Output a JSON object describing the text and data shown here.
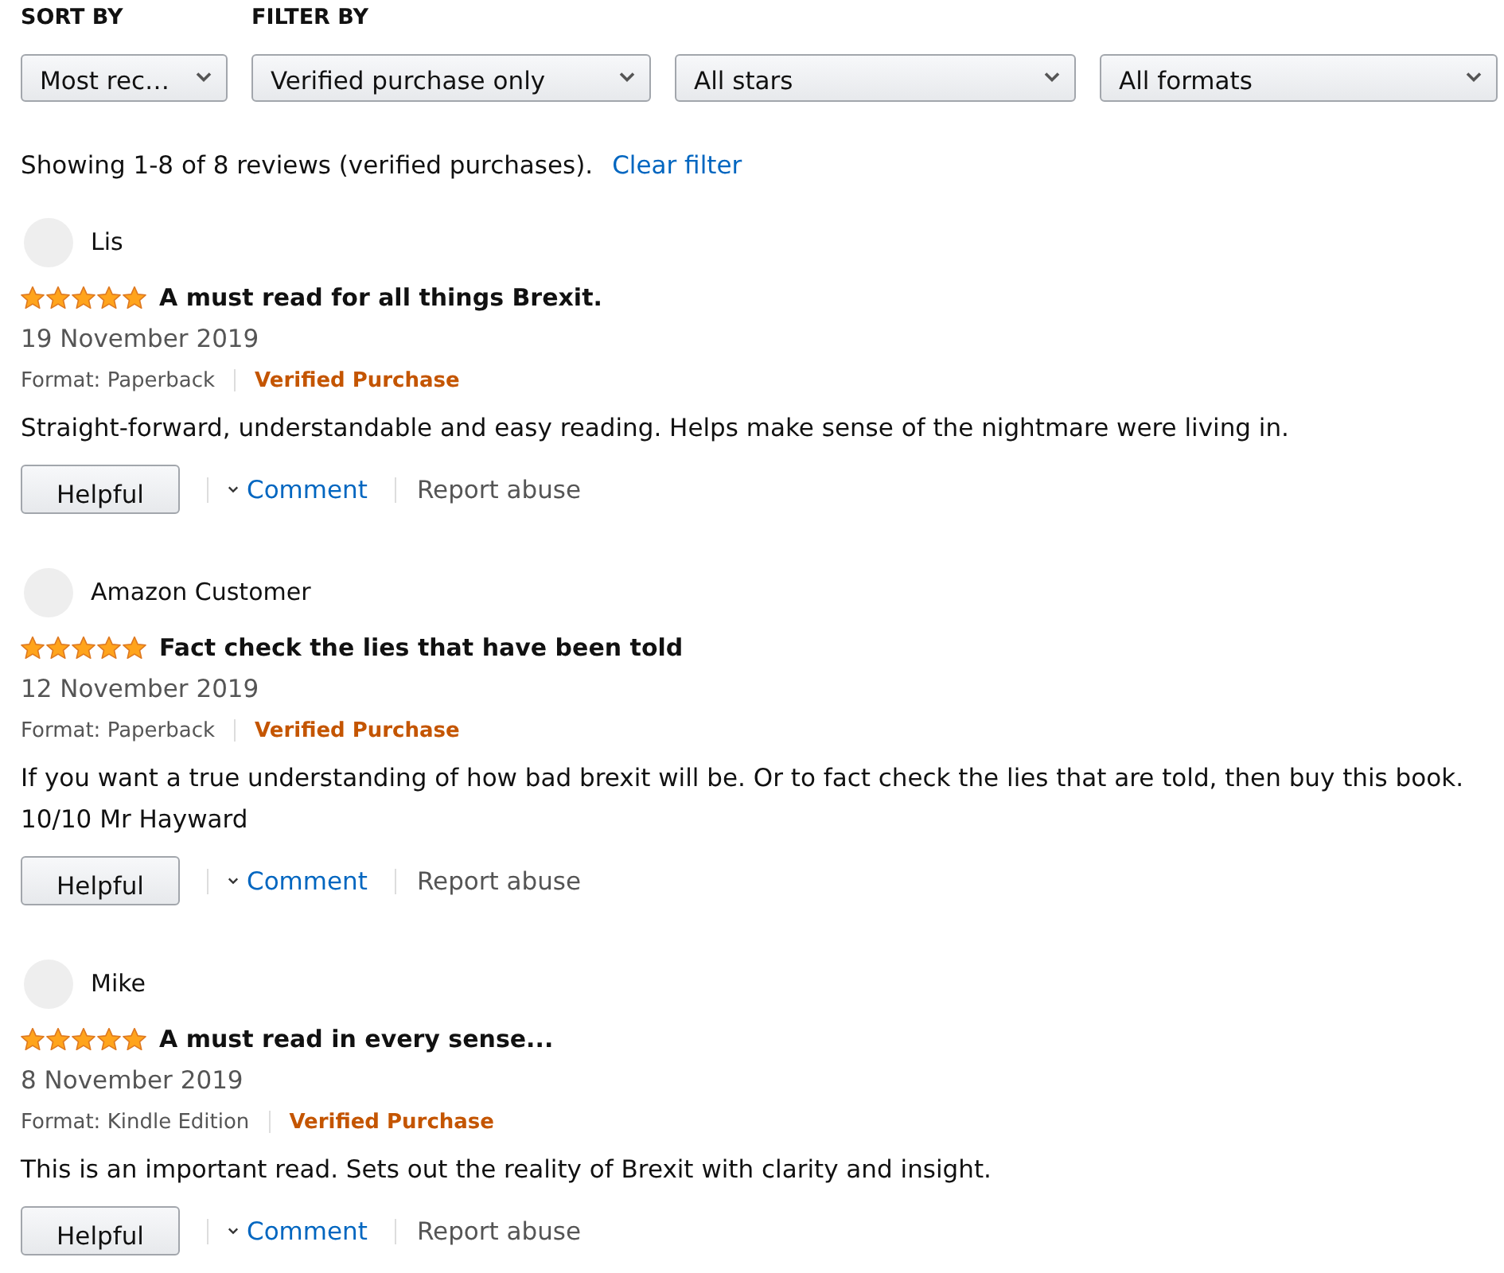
{
  "sort": {
    "label": "SORT BY",
    "value": "Most rec…"
  },
  "filter": {
    "label": "FILTER BY",
    "dropdowns": [
      {
        "value": "Verified purchase only"
      },
      {
        "value": "All stars"
      },
      {
        "value": "All formats"
      }
    ]
  },
  "summary": {
    "text": "Showing 1-8 of 8 reviews (verified purchases).",
    "clear_link": "Clear filter"
  },
  "reviews": [
    {
      "author": "Lis",
      "stars": 5,
      "title": "A must read for all things Brexit.",
      "date": "19 November 2019",
      "format": "Format: Paperback",
      "badge": "Verified Purchase",
      "body": "Straight-forward, understandable and easy reading. Helps make sense of the nightmare were living in.",
      "helpful_button": "Helpful",
      "comment_link": "Comment",
      "report_link": "Report abuse"
    },
    {
      "author": "Amazon Customer",
      "stars": 5,
      "title": "Fact check the lies that have been told",
      "date": "12 November 2019",
      "format": "Format: Paperback",
      "badge": "Verified Purchase",
      "body": "If you want a true understanding of how bad brexit will be. Or to fact check the lies that are told, then buy this book. 10/10 Mr Hayward",
      "helpful_button": "Helpful",
      "comment_link": "Comment",
      "report_link": "Report abuse"
    },
    {
      "author": "Mike",
      "stars": 5,
      "title": "A must read in every sense...",
      "date": "8 November 2019",
      "format": "Format: Kindle Edition",
      "badge": "Verified Purchase",
      "body": "This is an important read. Sets out the reality of Brexit with clarity and insight.",
      "helpful_button": "Helpful",
      "comment_link": "Comment",
      "report_link": "Report abuse"
    }
  ]
}
